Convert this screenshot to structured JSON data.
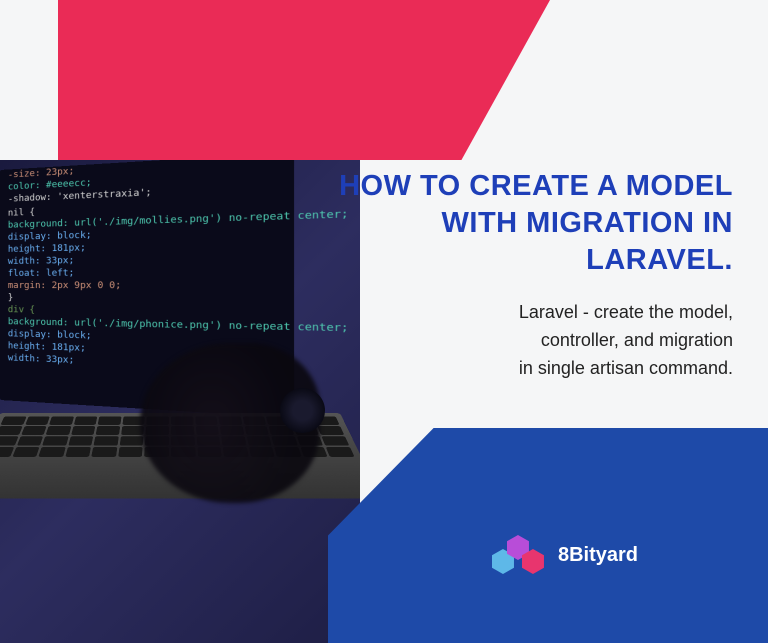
{
  "title": "HOW TO CREATE A MODEL WITH MIGRATION IN LARAVEL.",
  "subtitle_l1": "Laravel - create the model,",
  "subtitle_l2": "controller, and migration",
  "subtitle_l3": "in single artisan command.",
  "brand": {
    "name": "8Bityard"
  },
  "colors": {
    "pink": "#ea2b56",
    "blue": "#1e4aa8",
    "title": "#1e3fb8"
  },
  "code": {
    "l1": "-size: 23px;",
    "l2": "color: #eeeecc;",
    "l3": "-shadow: 'xenterstraxia';",
    "l4": " ",
    "l5": "nil {",
    "l6": "  background: url('./img/mollies.png') no-repeat center;",
    "l7": "  display: block;",
    "l8": "  height: 181px;",
    "l9": "  width: 33px;",
    "l10": "  float: left;",
    "l11": "  margin: 2px 9px 0 0;",
    "l12": "}",
    "l13": "div {",
    "l14": "  background: url('./img/phonice.png') no-repeat center;",
    "l15": "  display: block;",
    "l16": "  height: 181px;",
    "l17": "  width: 33px;"
  }
}
